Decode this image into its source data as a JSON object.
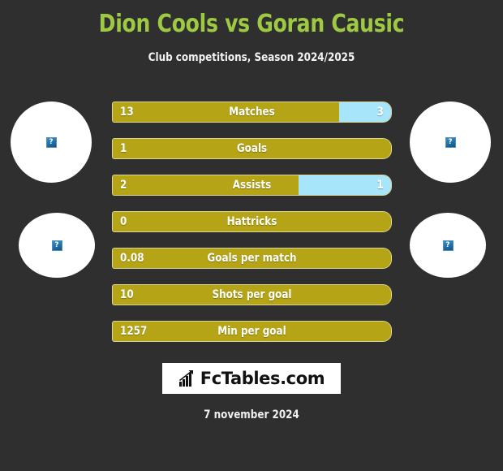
{
  "header": {
    "title": "Dion Cools vs Goran Causic",
    "subtitle": "Club competitions, Season 2024/2025",
    "title_color": "#9DC943"
  },
  "avatars": {
    "placeholder_glyph": "?",
    "items": [
      {
        "name": "home-player-photo-top",
        "position": "left-top"
      },
      {
        "name": "away-player-photo-top",
        "position": "right-top"
      },
      {
        "name": "home-player-photo-bottom",
        "position": "left-bottom"
      },
      {
        "name": "away-player-photo-bottom",
        "position": "right-bottom"
      }
    ]
  },
  "colors": {
    "background": "#2F2F2F",
    "home_bar": "#B5A516",
    "away_bar": "#A6E5FA",
    "text": "#FFFFFF"
  },
  "logo": {
    "text": "FcTables.com",
    "icon": "bar-chart-icon"
  },
  "footer": {
    "date": "7 november 2024"
  },
  "chart_data": {
    "type": "bar",
    "title": "Dion Cools vs Goran Causic",
    "subtitle": "Club competitions, Season 2024/2025",
    "xlabel": "",
    "ylabel": "",
    "orientation": "horizontal",
    "layout": "diverging-comparison",
    "legend": [
      "Dion Cools",
      "Goran Causic"
    ],
    "legend_position": "none",
    "grid": false,
    "categories": [
      "Matches",
      "Goals",
      "Assists",
      "Hattricks",
      "Goals per match",
      "Shots per goal",
      "Min per goal"
    ],
    "series": [
      {
        "name": "Dion Cools",
        "side": "home",
        "color": "#B5A516",
        "values": [
          13,
          1,
          2,
          0,
          0.08,
          10,
          1257
        ],
        "labels": [
          "13",
          "1",
          "2",
          "0",
          "0.08",
          "10",
          "1257"
        ]
      },
      {
        "name": "Goran Causic",
        "side": "away",
        "color": "#A6E5FA",
        "values": [
          3,
          0,
          1,
          0,
          0,
          0,
          0
        ],
        "labels": [
          "3",
          "",
          "1",
          "",
          "",
          "",
          ""
        ]
      }
    ],
    "rows": [
      {
        "label": "Matches",
        "home": "13",
        "away": "3",
        "home_pct": 81.3,
        "away_visible": true
      },
      {
        "label": "Goals",
        "home": "1",
        "away": "",
        "home_pct": 100,
        "away_visible": false
      },
      {
        "label": "Assists",
        "home": "2",
        "away": "1",
        "home_pct": 66.7,
        "away_visible": true
      },
      {
        "label": "Hattricks",
        "home": "0",
        "away": "",
        "home_pct": 100,
        "away_visible": false
      },
      {
        "label": "Goals per match",
        "home": "0.08",
        "away": "",
        "home_pct": 100,
        "away_visible": false
      },
      {
        "label": "Shots per goal",
        "home": "10",
        "away": "",
        "home_pct": 100,
        "away_visible": false
      },
      {
        "label": "Min per goal",
        "home": "1257",
        "away": "",
        "home_pct": 100,
        "away_visible": false
      }
    ]
  }
}
